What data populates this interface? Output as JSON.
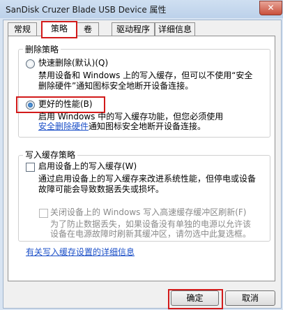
{
  "window": {
    "title": "SanDisk Cruzer Blade USB Device 属性",
    "close_glyph": "✕"
  },
  "tabs": [
    {
      "label": "常规"
    },
    {
      "label": "策略"
    },
    {
      "label": "卷"
    },
    {
      "label": "驱动程序"
    },
    {
      "label": "详细信息"
    }
  ],
  "removal_policy": {
    "title": "删除策略",
    "quick": {
      "label": "快速删除(默认)(Q)",
      "desc_1": "禁用设备和 Windows 上的写入缓存，但可以不使用“安全",
      "desc_2": "删除硬件”通知图标安全地断开设备连接。"
    },
    "better": {
      "label": "更好的性能(B)",
      "desc_1": "启用 Windows 中的写入缓存功能，但您必须使用",
      "desc_link": "安全删除硬件",
      "desc_2": "通知图标安全地断开设备连接。"
    }
  },
  "write_cache_policy": {
    "title": "写入缓存策略",
    "enable": {
      "label": "启用设备上的写入缓存(W)",
      "desc_1": "通过启用设备上的写入缓存来改进系统性能，但停电或设备",
      "desc_2": "故障可能会导致数据丢失或损坏。"
    },
    "flush": {
      "label": "关闭设备上的 Windows 写入高速缓存缓冲区刷新(F)",
      "desc_1": "为了防止数据丢失，如果设备没有单独的电源以允许该",
      "desc_2": "设备在电源故障时刷新其缓冲区，请勿选中此复选框。"
    }
  },
  "details_link": "有关写入缓存设置的详细信息",
  "buttons": {
    "ok": "确定",
    "cancel": "取消"
  },
  "selected_tab": "策略",
  "selected_removal_option": "更好的性能(B)",
  "colors": {
    "highlight": "#d21a1a",
    "link": "#1c50c8"
  }
}
